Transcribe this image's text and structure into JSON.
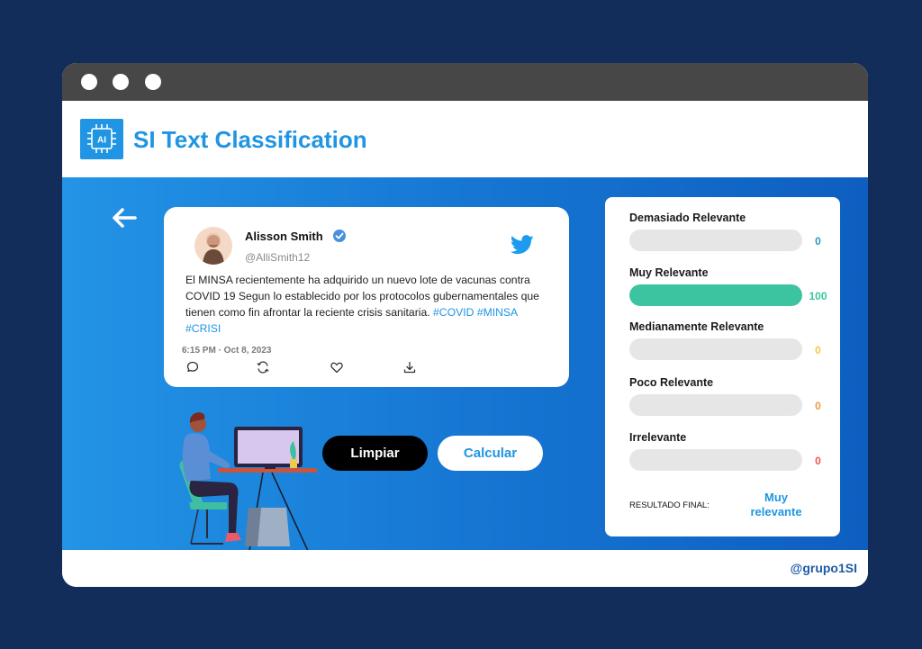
{
  "app": {
    "title": "SI Text Classification",
    "logo_text": "AI",
    "footer_handle": "@grupo1SI"
  },
  "tweet": {
    "name": "Alisson Smith",
    "handle": "@AlliSmith12",
    "text": "El MINSA recientemente ha adquirido un nuevo lote de vacunas contra COVID 19 Segun lo establecido por los protocolos gubernamentales que tienen como fin afrontar la reciente crisis sanitaria.",
    "hashtags": [
      "#COVID",
      "#MINSA",
      "#CRISI"
    ],
    "time": "6:15 PM · Oct 8, 2023",
    "actions": [
      "reply-icon",
      "retweet-icon",
      "like-icon",
      "download-icon"
    ]
  },
  "buttons": {
    "clear": "Limpiar",
    "calculate": "Calcular"
  },
  "results": {
    "categories": [
      {
        "label": "Demasiado Relevante",
        "value": "0",
        "percent": 0,
        "color": "#2a9bb5"
      },
      {
        "label": "Muy Relevante",
        "value": "100",
        "percent": 100,
        "color": "#3cc39f"
      },
      {
        "label": "Medianamente Relevante",
        "value": "0",
        "percent": 0,
        "color": "#f2c94c"
      },
      {
        "label": "Poco Relevante",
        "value": "0",
        "percent": 0,
        "color": "#f2994a"
      },
      {
        "label": "Irrelevante",
        "value": "0",
        "percent": 0,
        "color": "#eb5757"
      }
    ],
    "final_label": "RESULTADO FINAL:",
    "final_value_line1": "Muy",
    "final_value_line2": "relevante"
  }
}
